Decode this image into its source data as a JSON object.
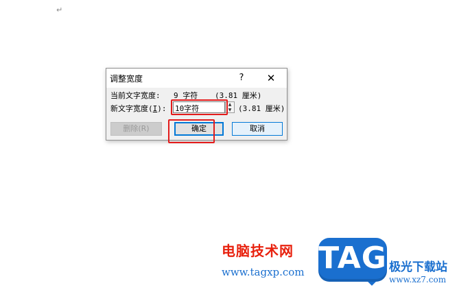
{
  "document": {
    "paragraph_mark": "↵"
  },
  "dialog": {
    "title": "调整宽度",
    "help_label": "?",
    "close_label": "✕",
    "current_width_label": "当前文字宽度:",
    "current_width_value": "9 字符",
    "current_width_cm": "(3.81 厘米)",
    "new_width_label_prefix": "新文字宽度(",
    "new_width_label_key": "I",
    "new_width_label_suffix": "):",
    "new_width_value": "10字符",
    "new_width_cm": "(3.81 厘米)",
    "spin_up": "▲",
    "spin_down": "▼",
    "delete_label": "删除(R)",
    "ok_label": "确定",
    "cancel_label": "取消"
  },
  "annotations": {
    "highlight_color": "#e31b1b"
  },
  "watermark": {
    "title": "电脑技术网",
    "url": "www.tagxp.com",
    "logo_text": "TAG",
    "site_name": "极光下载站",
    "site_url": "www.xz7.com",
    "title_color": "#e8210e",
    "brand_color": "#1a6fcf"
  }
}
